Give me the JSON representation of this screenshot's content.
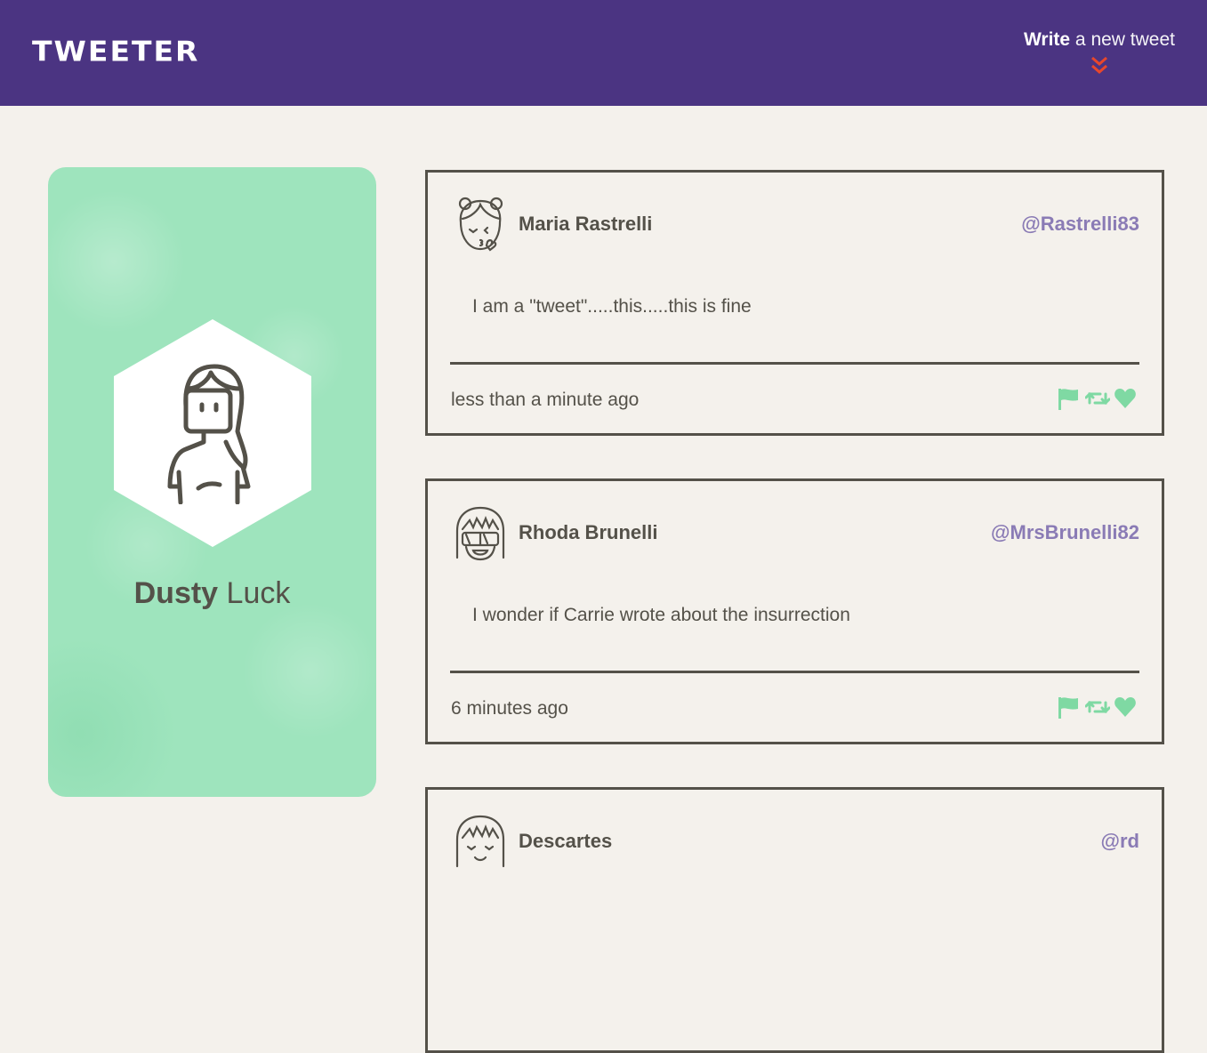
{
  "nav": {
    "logo": "TWEETER",
    "write_bold": "Write",
    "write_rest": " a new tweet",
    "chevron_color": "#e8472b",
    "bg_color": "#4b3482"
  },
  "profile": {
    "first_name": "Dusty",
    "last_name": " Luck",
    "card_color": "#9ee4bd"
  },
  "tweets": [
    {
      "name": "Maria Rastrelli",
      "handle": "@Rastrelli83",
      "content": "I am a \"tweet\".....this.....this is fine",
      "time": "less than a minute ago"
    },
    {
      "name": "Rhoda Brunelli",
      "handle": "@MrsBrunelli82",
      "content": "I wonder if Carrie wrote about the insurrection",
      "time": "6 minutes ago"
    },
    {
      "name": "Descartes",
      "handle": "@rd",
      "content": "",
      "time": ""
    }
  ],
  "icons": {
    "flag": "flag-icon",
    "retweet": "retweet-icon",
    "like": "heart-icon",
    "action_color": "#7fd9a3",
    "handle_color": "#8a7bb5"
  }
}
